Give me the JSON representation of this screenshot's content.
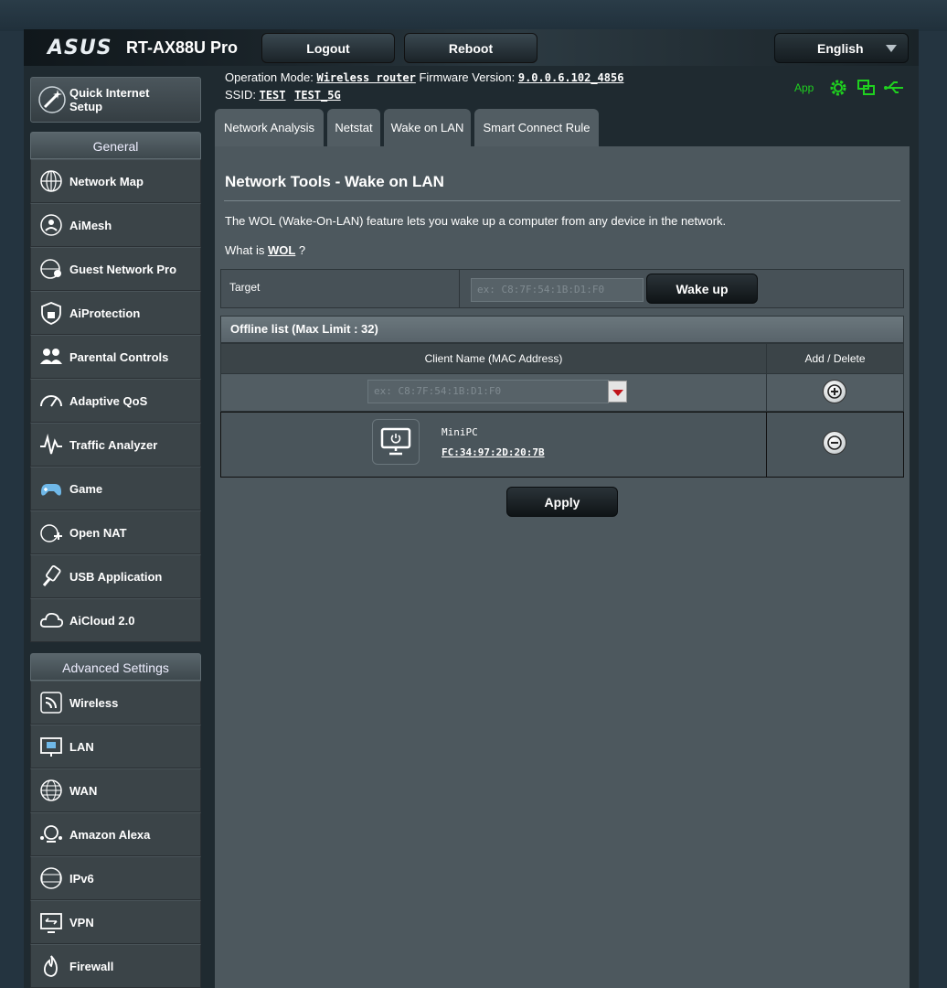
{
  "header": {
    "brand": "ASUS",
    "model": "RT-AX88U Pro",
    "logout_label": "Logout",
    "reboot_label": "Reboot",
    "language": "English"
  },
  "info": {
    "operation_mode_label": "Operation Mode:",
    "operation_mode_value": "Wireless router",
    "firmware_label": "Firmware Version:",
    "firmware_value": "9.0.0.6.102_4856",
    "ssid_label": "SSID:",
    "ssid_1": "TEST",
    "ssid_2": "TEST_5G",
    "app_label": "App"
  },
  "sidebar": {
    "qis_line1": "Quick Internet",
    "qis_line2": "Setup",
    "general_title": "General",
    "general_items": [
      {
        "label": "Network Map",
        "icon": "network-map-icon"
      },
      {
        "label": "AiMesh",
        "icon": "aimesh-icon"
      },
      {
        "label": "Guest Network Pro",
        "icon": "guest-network-icon"
      },
      {
        "label": "AiProtection",
        "icon": "aiprotection-icon"
      },
      {
        "label": "Parental Controls",
        "icon": "parental-controls-icon"
      },
      {
        "label": "Adaptive QoS",
        "icon": "adaptive-qos-icon"
      },
      {
        "label": "Traffic Analyzer",
        "icon": "traffic-analyzer-icon"
      },
      {
        "label": "Game",
        "icon": "game-icon"
      },
      {
        "label": "Open NAT",
        "icon": "open-nat-icon"
      },
      {
        "label": "USB Application",
        "icon": "usb-icon"
      },
      {
        "label": "AiCloud 2.0",
        "icon": "aicloud-icon"
      }
    ],
    "advanced_title": "Advanced Settings",
    "advanced_items": [
      {
        "label": "Wireless",
        "icon": "wireless-icon"
      },
      {
        "label": "LAN",
        "icon": "lan-icon"
      },
      {
        "label": "WAN",
        "icon": "wan-icon"
      },
      {
        "label": "Amazon Alexa",
        "icon": "alexa-icon"
      },
      {
        "label": "IPv6",
        "icon": "ipv6-icon"
      },
      {
        "label": "VPN",
        "icon": "vpn-icon"
      },
      {
        "label": "Firewall",
        "icon": "firewall-icon"
      }
    ]
  },
  "tabs": [
    {
      "label": "Network Analysis"
    },
    {
      "label": "Netstat"
    },
    {
      "label": "Wake on LAN"
    },
    {
      "label": "Smart Connect Rule"
    }
  ],
  "main": {
    "title": "Network Tools - Wake on LAN",
    "description": "The WOL (Wake-On-LAN) feature lets you wake up a computer from any device in the network.",
    "what_is_prefix": "What is",
    "what_is_link": "WOL",
    "what_is_suffix": "?",
    "target_label": "Target",
    "target_placeholder": "ex: C8:7F:54:1B:D1:F0",
    "wake_up_label": "Wake up",
    "offline_list_title": "Offline list (Max Limit : 32)",
    "col_client": "Client Name (MAC Address)",
    "col_add_delete": "Add / Delete",
    "new_client_placeholder": "ex: C8:7F:54:1B:D1:F0",
    "clients": [
      {
        "name": "MiniPC",
        "mac": "FC:34:97:2D:20:7B"
      }
    ],
    "apply_label": "Apply"
  },
  "colors": {
    "accent_green": "#1fd11f",
    "content_bg": "#4d585e",
    "dropdown_arrow": "#c0141a"
  }
}
